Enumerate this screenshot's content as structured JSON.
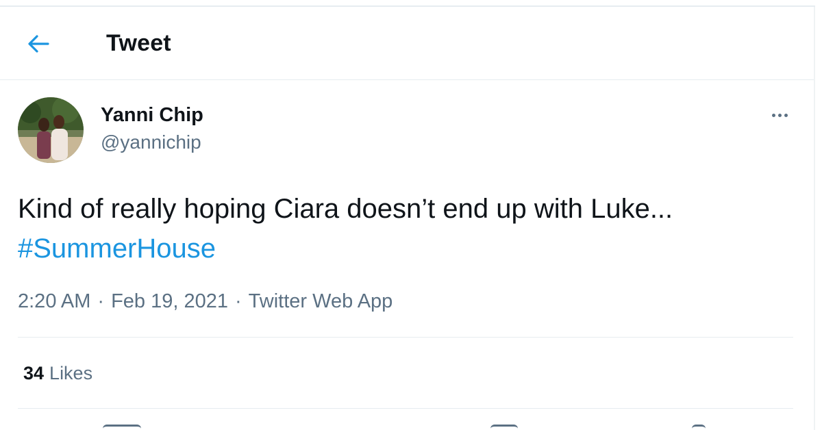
{
  "header": {
    "title": "Tweet",
    "back_icon": "arrow-left-icon"
  },
  "author": {
    "display_name": "Yanni Chip",
    "handle": "@yannichip",
    "avatar_icon": "avatar-photo"
  },
  "tweet": {
    "text": "Kind of really hoping Ciara doesn’t end up with Luke...",
    "hashtag": "#SummerHouse"
  },
  "meta": {
    "time": "2:20 AM",
    "separator": "·",
    "date": "Feb 19, 2021",
    "source": "Twitter Web App"
  },
  "stats": {
    "likes_count": "34",
    "likes_label": "Likes"
  },
  "colors": {
    "accent": "#1b95e0",
    "text_primary": "#0f1419",
    "text_secondary": "#5b7083",
    "divider": "#e6ecf0"
  }
}
